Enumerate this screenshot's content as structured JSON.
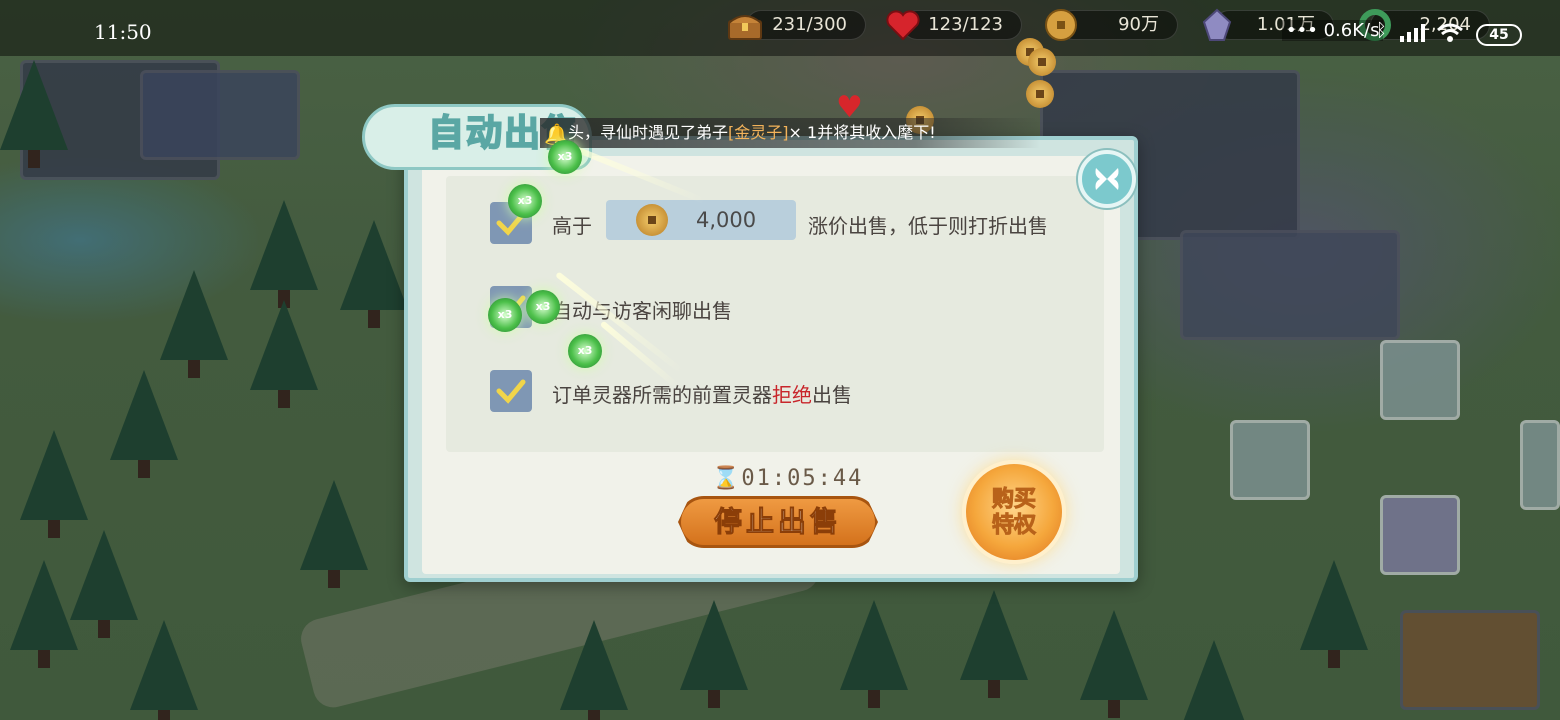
{
  "status_bar": {
    "time": "11:50",
    "network_speed": "0.6K/s",
    "battery": "45"
  },
  "resources": {
    "chest": {
      "value": "231/300",
      "icon": "treasure-chest-icon"
    },
    "heart": {
      "value": "123/123",
      "icon": "heart-icon"
    },
    "coin": {
      "value": "90万",
      "icon": "coin-icon"
    },
    "crystal": {
      "value": "1.01万",
      "icon": "crystal-icon"
    },
    "jade": {
      "value": "2,204",
      "icon": "jade-icon"
    }
  },
  "dialog": {
    "title": "自动出售",
    "notice": {
      "prefix": "头，寻仙时遇见了弟子",
      "highlight": "[金灵子]",
      "suffix": "× 1并将其收入麾下!"
    },
    "options": [
      {
        "checked": true,
        "label_prefix": "高于",
        "price": "4,000",
        "label_suffix": "涨价出售，低于则打折出售"
      },
      {
        "checked": true,
        "label": "自动与访客闲聊出售"
      },
      {
        "checked": true,
        "label_prefix": "订单灵器所需的前置灵器",
        "label_red": "拒绝",
        "label_suffix": "出售"
      }
    ],
    "timer": "01:05:44",
    "stop_button": "停止出售",
    "buy_button": "购买特权"
  },
  "colors": {
    "accent_teal": "#7cc9cd",
    "stop_orange": "#e0832a",
    "reject_red": "#c8262b",
    "checkbox_blue": "#7f97b4",
    "check_yellow": "#f1d54a"
  }
}
